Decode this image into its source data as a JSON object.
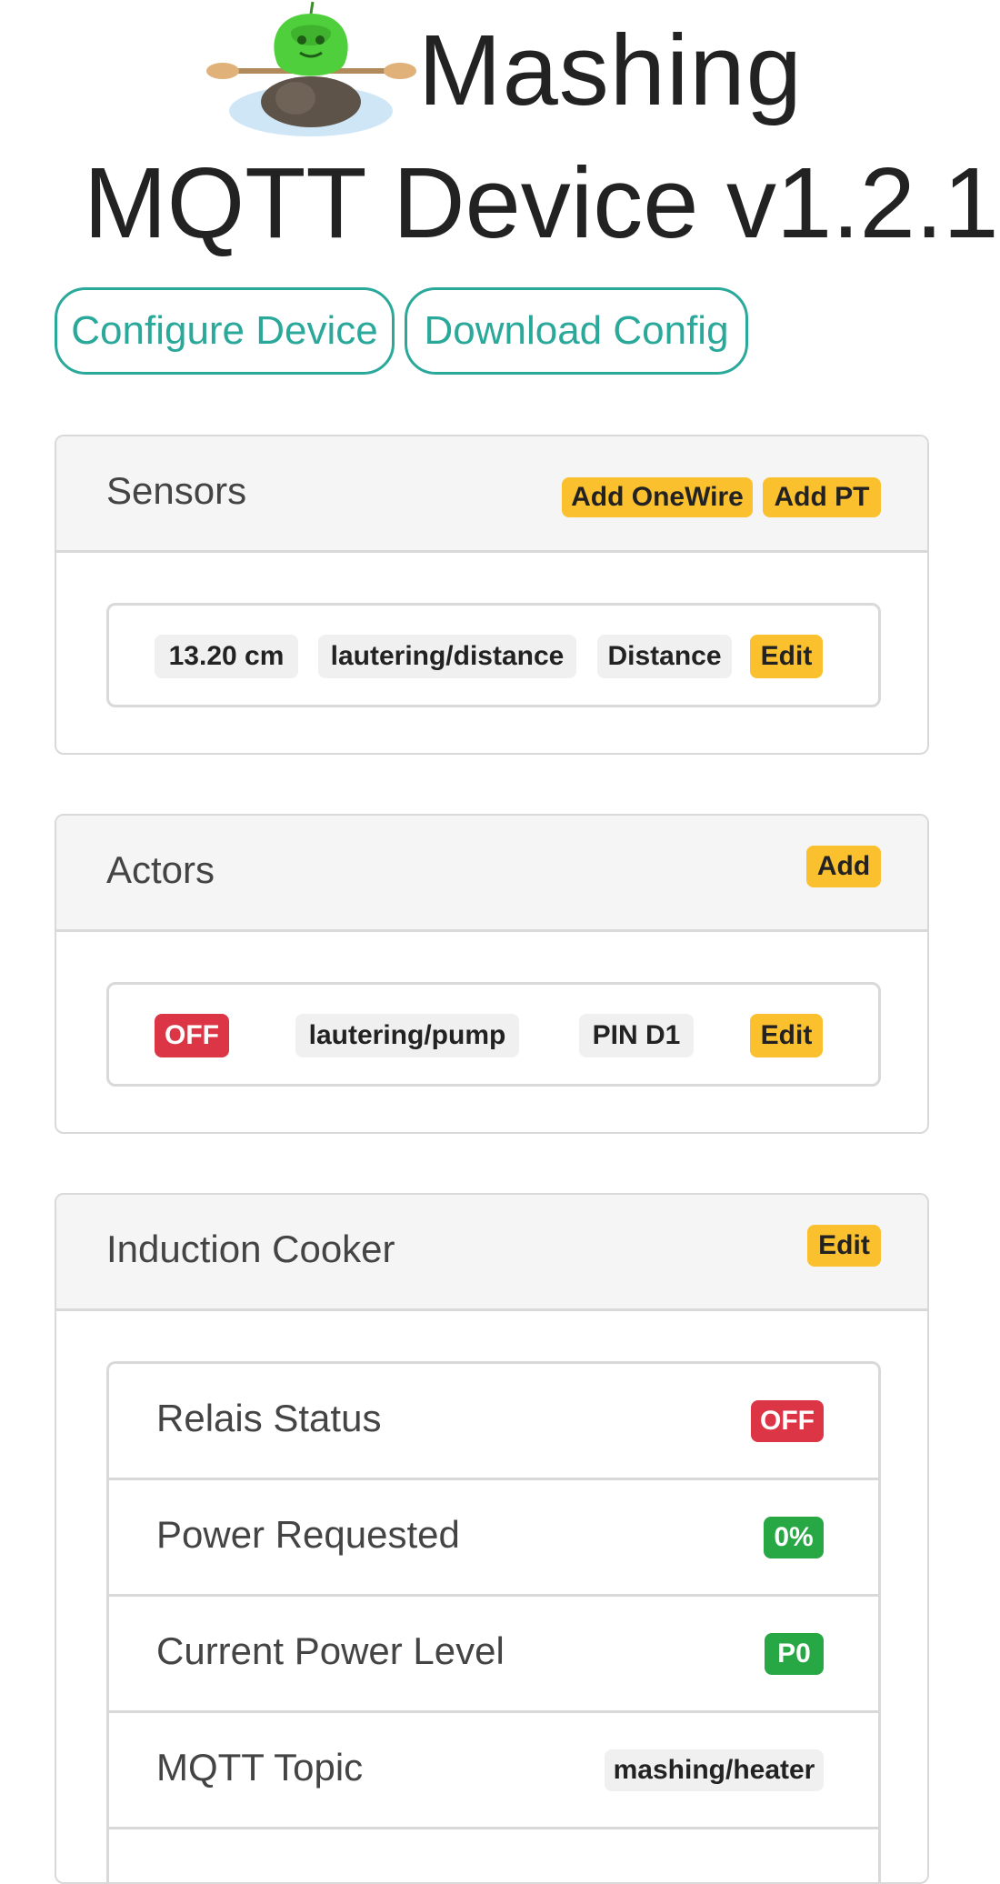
{
  "header": {
    "title_line1": "Mashing",
    "title_line2": "MQTT Device v1.2.1"
  },
  "top_buttons": {
    "configure_label": "Configure Device",
    "download_label": "Download Config"
  },
  "sensors": {
    "title": "Sensors",
    "add_onewire_label": "Add OneWire",
    "add_pt_label": "Add PT",
    "items": [
      {
        "value": "13.20 cm",
        "topic": "lautering/distance",
        "name": "Distance",
        "edit_label": "Edit"
      }
    ]
  },
  "actors": {
    "title": "Actors",
    "add_label": "Add",
    "items": [
      {
        "state": "OFF",
        "topic": "lautering/pump",
        "pin": "PIN D1",
        "edit_label": "Edit"
      }
    ]
  },
  "induction": {
    "title": "Induction Cooker",
    "edit_label": "Edit",
    "rows": [
      {
        "label": "Relais Status",
        "value": "OFF"
      },
      {
        "label": "Power Requested",
        "value": "0%"
      },
      {
        "label": "Current Power Level",
        "value": "P0"
      },
      {
        "label": "MQTT Topic",
        "value": "mashing/heater"
      }
    ]
  },
  "colors": {
    "accent": "#2aa89a",
    "warning": "#fbc02d",
    "danger": "#dc3545",
    "success": "#28a745"
  }
}
